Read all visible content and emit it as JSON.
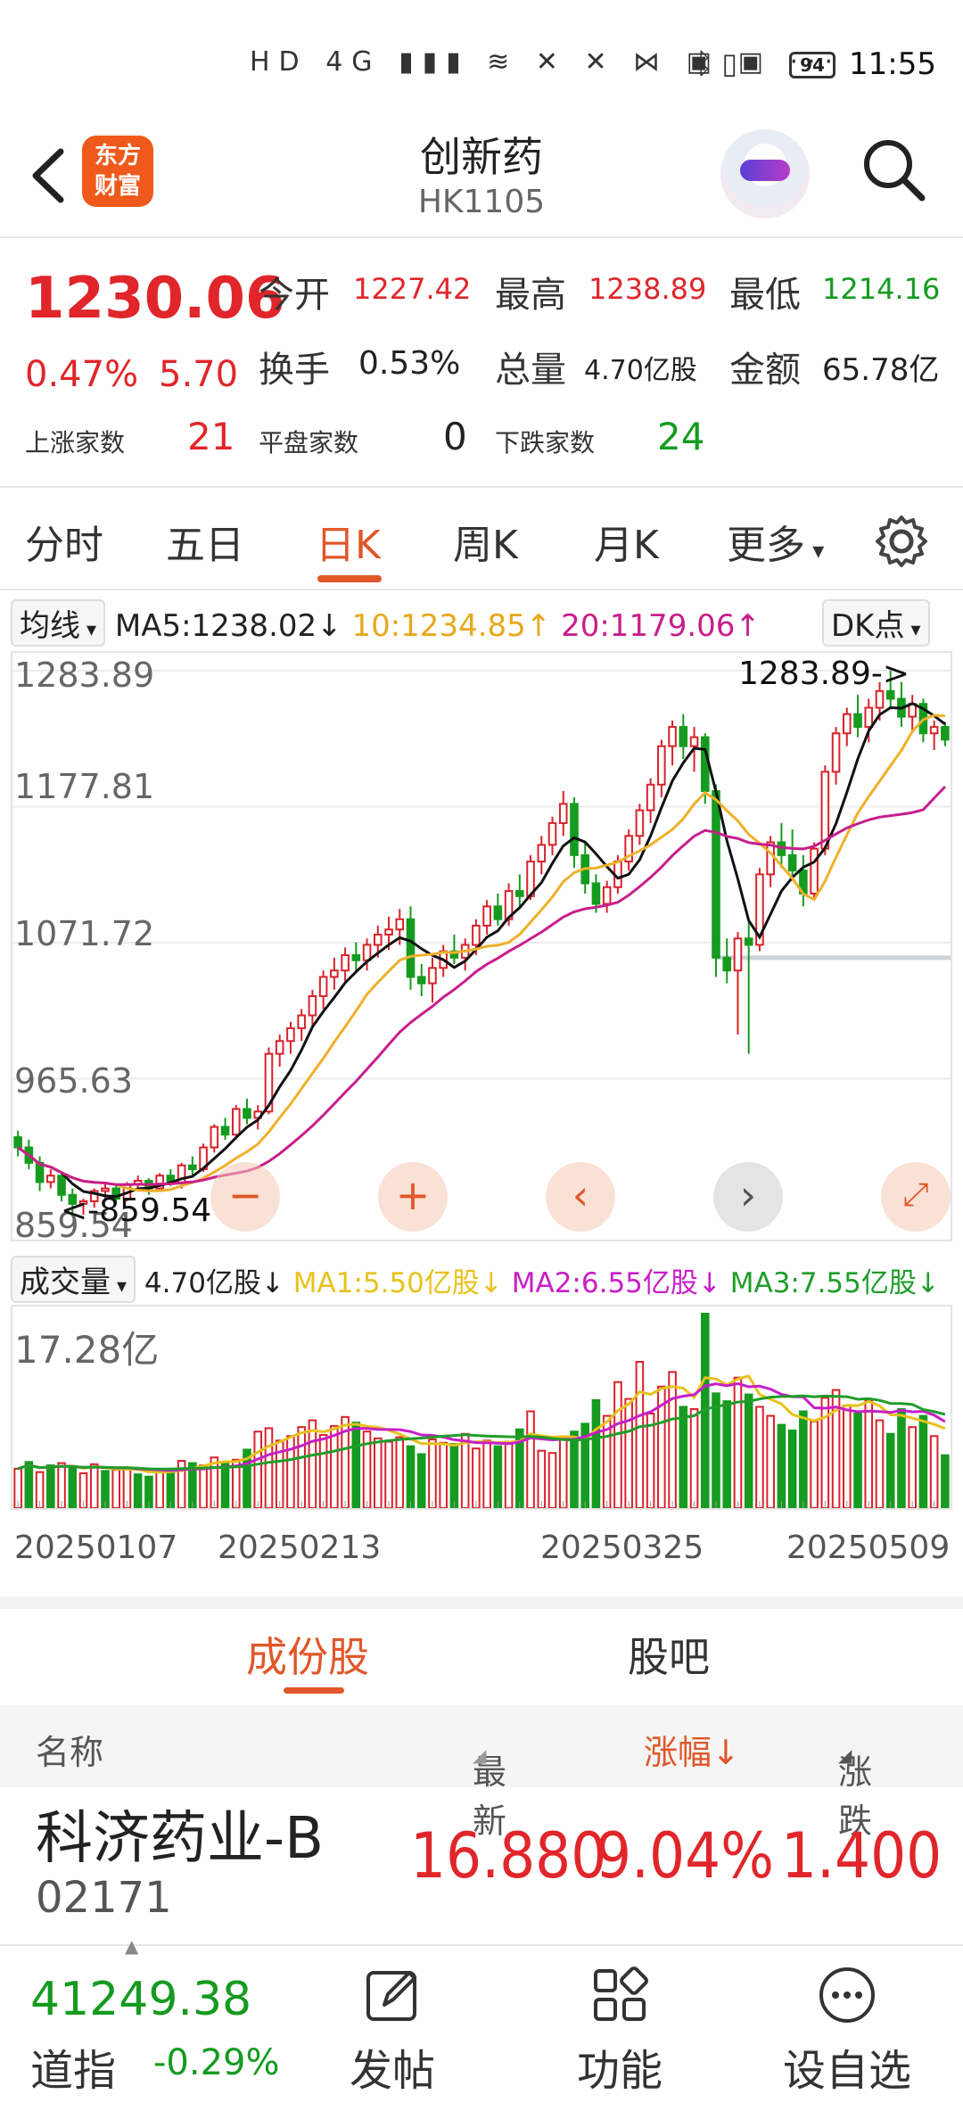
{
  "status_bar": {
    "icons_text": "HD 4G ▮▮▮ ≋ ✕ ✕ ⋈ ▣ ▣ ···",
    "battery": "94",
    "time": "11:55"
  },
  "header": {
    "back_icon": "chevron-left-icon",
    "logo_text_line1": "东方",
    "logo_text_line2": "财富",
    "title": "创新药",
    "code": "HK1105",
    "avatar_icon": "robot-avatar-icon",
    "search_icon": "search-icon"
  },
  "quote": {
    "price": "1230.06",
    "change_pct": "0.47%",
    "change_amt": "5.70",
    "open_label": "今开",
    "open": "1227.42",
    "high_label": "最高",
    "high": "1238.89",
    "low_label": "最低",
    "low": "1214.16",
    "turnover_label": "换手",
    "turnover": "0.53%",
    "volume_label": "总量",
    "volume": "4.70亿股",
    "amount_label": "金额",
    "amount": "65.78亿",
    "up_label": "上涨家数",
    "up_count": "21",
    "flat_label": "平盘家数",
    "flat_count": "0",
    "down_label": "下跌家数",
    "down_count": "24"
  },
  "tabs": [
    "分时",
    "五日",
    "日K",
    "周K",
    "月K",
    "更多"
  ],
  "active_tab": "日K",
  "settings_icon": "gear-icon",
  "ma_bar": {
    "selector": "均线",
    "ma5": "MA5:1238.02↓",
    "ma10": "10:1234.85↑",
    "ma20": "20:1179.06↑",
    "dk_button": "DK点",
    "colors": {
      "ma5": "#111111",
      "ma10": "#f0b02a",
      "ma20": "#c81e8c"
    }
  },
  "price_axis": [
    "1283.89",
    "1177.81",
    "1071.72",
    "965.63",
    "859.54"
  ],
  "price_annotations": {
    "max_label": "1283.89->",
    "min_label": "<-859.54"
  },
  "chart_controls": [
    "minus",
    "plus",
    "left",
    "right",
    "expand"
  ],
  "volume_bar": {
    "selector": "成交量",
    "volume": "4.70亿股↓",
    "ma1": "MA1:5.50亿股↓",
    "ma2": "MA2:6.55亿股↓",
    "ma3": "MA3:7.55亿股↓",
    "colors": {
      "ma1": "#e8c21c",
      "ma2": "#c81ec8",
      "ma3": "#1f9d2a"
    }
  },
  "volume_axis_max": "17.28亿",
  "date_axis": [
    "20250107",
    "20250213",
    "20250325",
    "20250509"
  ],
  "chart_data": {
    "type": "candlestick",
    "ylim": [
      859.54,
      1283.89
    ],
    "candles_ohlc": [
      [
        920,
        925,
        905,
        912
      ],
      [
        912,
        918,
        895,
        900
      ],
      [
        900,
        905,
        878,
        885
      ],
      [
        885,
        895,
        880,
        890
      ],
      [
        890,
        892,
        870,
        875
      ],
      [
        875,
        880,
        860,
        868
      ],
      [
        868,
        872,
        859.54,
        870
      ],
      [
        870,
        880,
        865,
        878
      ],
      [
        878,
        885,
        872,
        880
      ],
      [
        880,
        882,
        868,
        872
      ],
      [
        872,
        885,
        870,
        883
      ],
      [
        883,
        890,
        878,
        886
      ],
      [
        886,
        888,
        875,
        880
      ],
      [
        880,
        892,
        878,
        890
      ],
      [
        890,
        895,
        882,
        884
      ],
      [
        884,
        900,
        880,
        898
      ],
      [
        898,
        905,
        890,
        895
      ],
      [
        895,
        915,
        893,
        912
      ],
      [
        912,
        930,
        908,
        928
      ],
      [
        928,
        935,
        918,
        922
      ],
      [
        922,
        945,
        918,
        942
      ],
      [
        942,
        950,
        930,
        935
      ],
      [
        935,
        945,
        926,
        940
      ],
      [
        940,
        990,
        938,
        985
      ],
      [
        985,
        1000,
        975,
        995
      ],
      [
        995,
        1010,
        985,
        1005
      ],
      [
        1005,
        1020,
        995,
        1015
      ],
      [
        1015,
        1035,
        1005,
        1030
      ],
      [
        1030,
        1050,
        1020,
        1045
      ],
      [
        1045,
        1060,
        1035,
        1050
      ],
      [
        1050,
        1068,
        1040,
        1062
      ],
      [
        1062,
        1072,
        1048,
        1058
      ],
      [
        1058,
        1075,
        1050,
        1070
      ],
      [
        1070,
        1085,
        1060,
        1078
      ],
      [
        1078,
        1092,
        1066,
        1082
      ],
      [
        1082,
        1098,
        1070,
        1090
      ],
      [
        1090,
        1100,
        1035,
        1045
      ],
      [
        1045,
        1055,
        1030,
        1040
      ],
      [
        1040,
        1060,
        1025,
        1052
      ],
      [
        1052,
        1070,
        1045,
        1065
      ],
      [
        1065,
        1078,
        1055,
        1060
      ],
      [
        1060,
        1075,
        1050,
        1070
      ],
      [
        1070,
        1090,
        1062,
        1085
      ],
      [
        1085,
        1105,
        1078,
        1100
      ],
      [
        1100,
        1110,
        1085,
        1090
      ],
      [
        1090,
        1118,
        1085,
        1112
      ],
      [
        1112,
        1125,
        1100,
        1108
      ],
      [
        1108,
        1140,
        1105,
        1135
      ],
      [
        1135,
        1155,
        1125,
        1148
      ],
      [
        1148,
        1170,
        1140,
        1165
      ],
      [
        1165,
        1190,
        1155,
        1180
      ],
      [
        1180,
        1185,
        1130,
        1140
      ],
      [
        1140,
        1150,
        1110,
        1118
      ],
      [
        1118,
        1125,
        1095,
        1102
      ],
      [
        1102,
        1120,
        1095,
        1115
      ],
      [
        1115,
        1140,
        1110,
        1135
      ],
      [
        1135,
        1160,
        1128,
        1155
      ],
      [
        1155,
        1180,
        1148,
        1175
      ],
      [
        1175,
        1200,
        1165,
        1195
      ],
      [
        1195,
        1230,
        1185,
        1225
      ],
      [
        1225,
        1245,
        1210,
        1240
      ],
      [
        1240,
        1250,
        1215,
        1225
      ],
      [
        1225,
        1240,
        1205,
        1232
      ],
      [
        1232,
        1235,
        1180,
        1190
      ],
      [
        1190,
        1195,
        1045,
        1060
      ],
      [
        1060,
        1075,
        1040,
        1050
      ],
      [
        1050,
        1080,
        1000,
        1075
      ],
      [
        1075,
        1090,
        985,
        1070
      ],
      [
        1070,
        1130,
        1065,
        1125
      ],
      [
        1125,
        1155,
        1115,
        1150
      ],
      [
        1150,
        1165,
        1130,
        1140
      ],
      [
        1140,
        1160,
        1120,
        1128
      ],
      [
        1128,
        1140,
        1100,
        1110
      ],
      [
        1110,
        1150,
        1105,
        1145
      ],
      [
        1145,
        1210,
        1140,
        1205
      ],
      [
        1205,
        1240,
        1195,
        1235
      ],
      [
        1235,
        1255,
        1225,
        1250
      ],
      [
        1250,
        1265,
        1232,
        1240
      ],
      [
        1240,
        1262,
        1228,
        1255
      ],
      [
        1255,
        1275,
        1245,
        1268
      ],
      [
        1268,
        1283.89,
        1255,
        1262
      ],
      [
        1262,
        1275,
        1240,
        1248
      ],
      [
        1248,
        1265,
        1235,
        1258
      ],
      [
        1258,
        1262,
        1228,
        1235
      ],
      [
        1235,
        1245,
        1222,
        1240
      ],
      [
        1240,
        1244,
        1225,
        1230.06
      ]
    ],
    "volume_max": 17.28,
    "volumes": [
      3.5,
      4.1,
      3.2,
      3.8,
      4.0,
      3.6,
      3.1,
      3.9,
      3.3,
      3.4,
      3.6,
      3.0,
      2.8,
      3.2,
      3.5,
      4.2,
      4.0,
      3.8,
      4.5,
      4.1,
      4.3,
      5.2,
      6.8,
      7.1,
      6.0,
      6.4,
      7.2,
      7.8,
      6.5,
      7.3,
      8.1,
      7.6,
      6.8,
      6.2,
      5.9,
      6.3,
      5.5,
      4.8,
      6.1,
      5.8,
      5.7,
      6.6,
      5.3,
      6.0,
      5.5,
      5.9,
      7.0,
      8.6,
      5.1,
      4.9,
      6.2,
      6.8,
      7.5,
      9.6,
      8.2,
      11.2,
      9.7,
      13.0,
      8.4,
      10.8,
      12.1,
      9.0,
      8.8,
      17.28,
      10.2,
      9.5,
      11.6,
      10.1,
      9.0,
      8.2,
      7.4,
      6.9,
      8.6,
      7.7,
      9.8,
      10.5,
      9.1,
      8.4,
      9.6,
      7.8,
      6.6,
      8.8,
      7.2,
      8.2,
      6.4,
      4.7
    ],
    "volume_up": [
      true,
      false,
      true,
      false,
      true,
      false,
      true,
      true,
      false,
      true,
      true,
      false,
      false,
      true,
      false,
      true,
      false,
      true,
      true,
      false,
      true,
      false,
      true,
      true,
      true,
      true,
      true,
      true,
      true,
      true,
      true,
      false,
      true,
      true,
      true,
      true,
      false,
      false,
      true,
      true,
      false,
      true,
      true,
      true,
      false,
      true,
      false,
      true,
      true,
      true,
      true,
      false,
      false,
      false,
      true,
      true,
      true,
      true,
      true,
      true,
      true,
      false,
      true,
      false,
      false,
      false,
      true,
      false,
      true,
      true,
      false,
      false,
      false,
      true,
      true,
      true,
      true,
      false,
      true,
      true,
      false,
      false,
      true,
      false,
      true,
      false
    ]
  },
  "sub_tabs": [
    "成份股",
    "股吧"
  ],
  "active_sub_tab": "成份股",
  "list_header": {
    "name": "名称",
    "latest": "最新",
    "change_pct": "涨幅↓",
    "change_amt": "涨跌"
  },
  "stocks": [
    {
      "name": "科济药业-B",
      "code": "02171",
      "latest": "16.880",
      "change_pct": "9.04%",
      "change_amt": "1.400"
    }
  ],
  "bottom_nav": {
    "index_value": "41249.38",
    "index_name": "道指",
    "index_change": "-0.29%",
    "items": [
      {
        "label": "发帖",
        "icon": "edit-icon"
      },
      {
        "label": "功能",
        "icon": "grid-icon"
      },
      {
        "label": "设自选",
        "icon": "more-dots-icon"
      }
    ]
  }
}
